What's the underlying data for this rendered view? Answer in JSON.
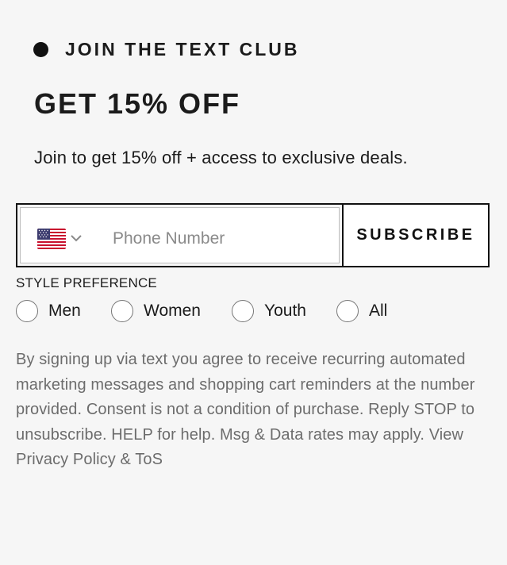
{
  "eyebrow": {
    "text": "JOIN THE TEXT CLUB"
  },
  "headline": "GET 15% OFF",
  "subtext": "Join to get 15% off + access to exclusive deals.",
  "form": {
    "country_icon": "us-flag-icon",
    "phone_placeholder": "Phone Number",
    "phone_value": "",
    "subscribe_label": "SUBSCRIBE"
  },
  "style_preference": {
    "label": "STYLE PREFERENCE",
    "options": [
      "Men",
      "Women",
      "Youth",
      "All"
    ],
    "selected": null
  },
  "legal": {
    "text": "By signing up via text you agree to receive recurring automated marketing messages and shopping cart reminders at the number provided. Consent is not a condition of purchase. Reply STOP to unsubscribe. HELP for help. Msg & Data rates may apply.",
    "privacy_link": "View Privacy Policy",
    "joiner": "&",
    "tos_link": "ToS"
  },
  "colors": {
    "background": "#f6f6f6",
    "text": "#1b1b1b",
    "muted_text": "#6c6c6c",
    "border": "#111111"
  }
}
